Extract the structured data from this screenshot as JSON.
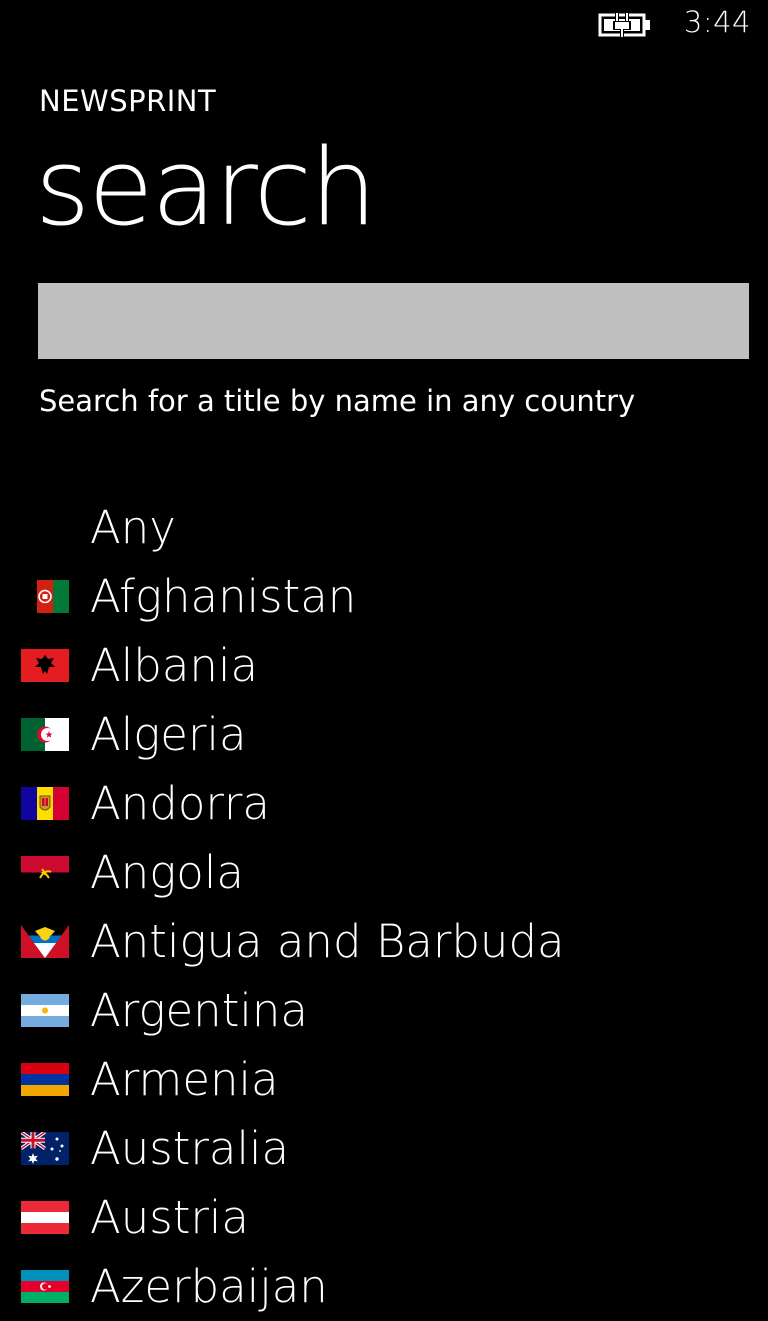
{
  "status_bar": {
    "time": "3:44",
    "battery_icon": "battery-charging-icon"
  },
  "app": {
    "title": "NEWSPRINT"
  },
  "page": {
    "title": "search"
  },
  "search": {
    "value": "",
    "placeholder": "",
    "hint": "Search for a title by name in any country"
  },
  "countries": [
    {
      "label": "Any",
      "flag": ""
    },
    {
      "label": "Afghanistan",
      "flag": "afghanistan-flag-icon"
    },
    {
      "label": "Albania",
      "flag": "albania-flag-icon"
    },
    {
      "label": "Algeria",
      "flag": "algeria-flag-icon"
    },
    {
      "label": "Andorra",
      "flag": "andorra-flag-icon"
    },
    {
      "label": "Angola",
      "flag": "angola-flag-icon"
    },
    {
      "label": "Antigua and Barbuda",
      "flag": "antigua-and-barbuda-flag-icon"
    },
    {
      "label": "Argentina",
      "flag": "argentina-flag-icon"
    },
    {
      "label": "Armenia",
      "flag": "armenia-flag-icon"
    },
    {
      "label": "Australia",
      "flag": "australia-flag-icon"
    },
    {
      "label": "Austria",
      "flag": "austria-flag-icon"
    },
    {
      "label": "Azerbaijan",
      "flag": "azerbaijan-flag-icon"
    }
  ]
}
